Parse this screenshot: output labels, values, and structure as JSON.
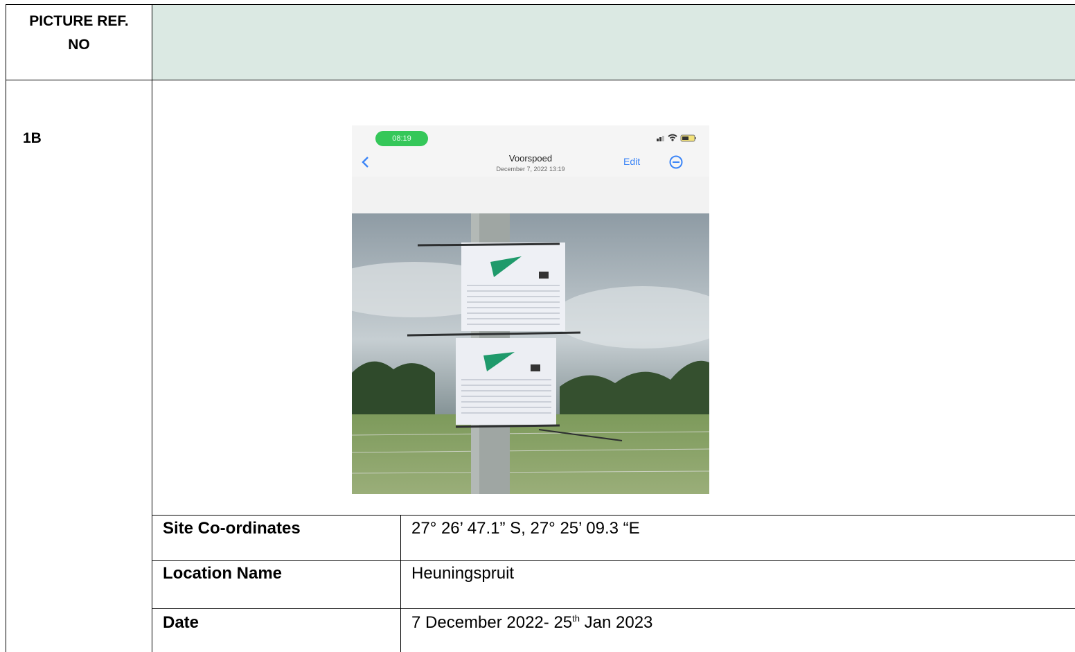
{
  "header": {
    "ref_label": "PICTURE REF.\nNO"
  },
  "row": {
    "ref": "1B"
  },
  "photo": {
    "status_time": "08:19",
    "album_title": "Voorspoed",
    "album_date": "December 7, 2022  13:19",
    "edit_label": "Edit",
    "icons": [
      "back-chevron-icon",
      "signal-icon",
      "wifi-icon",
      "battery-icon",
      "more-icon"
    ]
  },
  "details": {
    "coords_label": "Site Co-ordinates",
    "coords_value": "27° 26’ 47.1” S, 27° 25’ 09.3 “E",
    "location_label": "Location Name",
    "location_value": "Heuningspruit",
    "date_label": "Date",
    "date_value_pre": "7 December 2022- 25",
    "date_value_sup": "th",
    "date_value_post": " Jan 2023"
  },
  "colors": {
    "header_shade": "#dbe9e3",
    "status_pill": "#35c759",
    "ios_blue": "#3a84f7"
  }
}
